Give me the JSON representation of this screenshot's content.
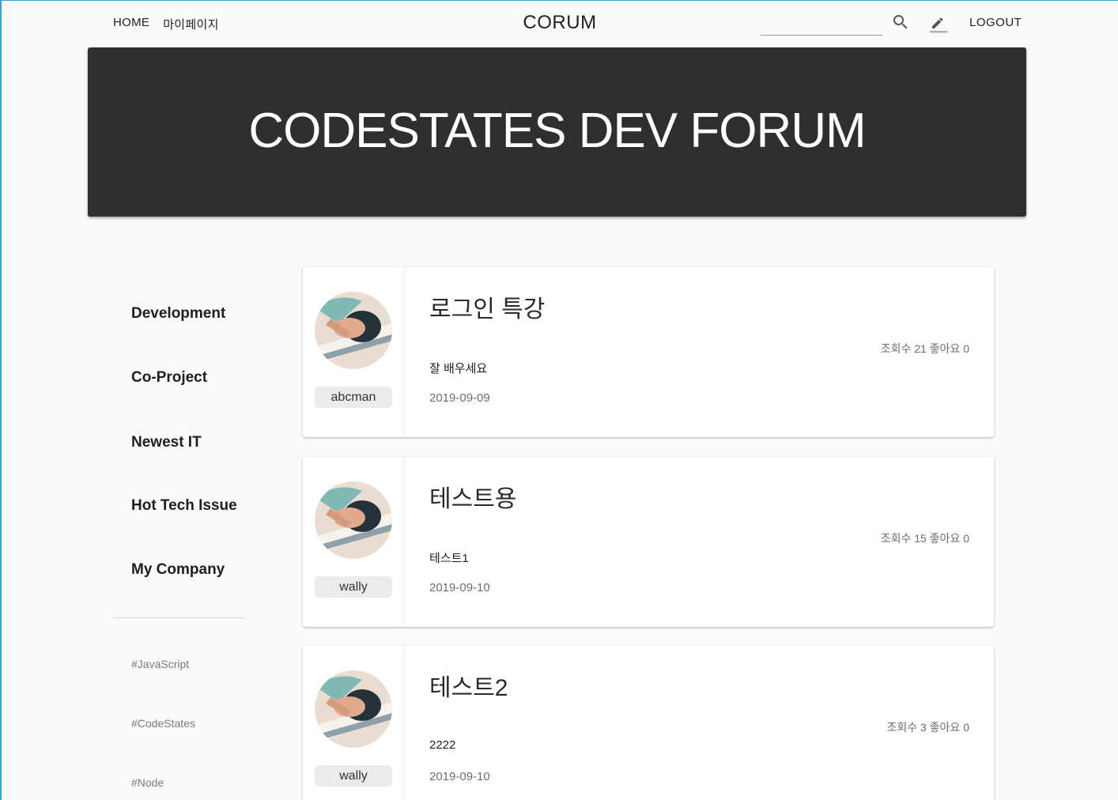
{
  "header": {
    "nav": [
      "HOME",
      "마이페이지"
    ],
    "brand": "CORUM",
    "search_value": "",
    "logout": "LOGOUT",
    "icons": [
      "search-icon",
      "pencil-icon"
    ]
  },
  "hero": {
    "title": "CODESTATES DEV FORUM",
    "background": "#2f2f2f"
  },
  "sidebar": {
    "categories": [
      "Development",
      "Co-Project",
      "Newest IT",
      "Hot Tech Issue",
      "My Company"
    ],
    "tags": [
      "#JavaScript",
      "#CodeStates",
      "#Node"
    ]
  },
  "posts": [
    {
      "title": "로그인 특강",
      "body": "잘 배우세요",
      "date": "2019-09-09",
      "author": "abcman",
      "stats": "조회수 21 좋아요 0"
    },
    {
      "title": "테스트용",
      "body": "테스트1",
      "date": "2019-09-10",
      "author": "wally",
      "stats": "조회수 15 좋아요 0"
    },
    {
      "title": "테스트2",
      "body": "2222",
      "date": "2019-09-10",
      "author": "wally",
      "stats": "조회수 3 좋아요 0"
    }
  ]
}
